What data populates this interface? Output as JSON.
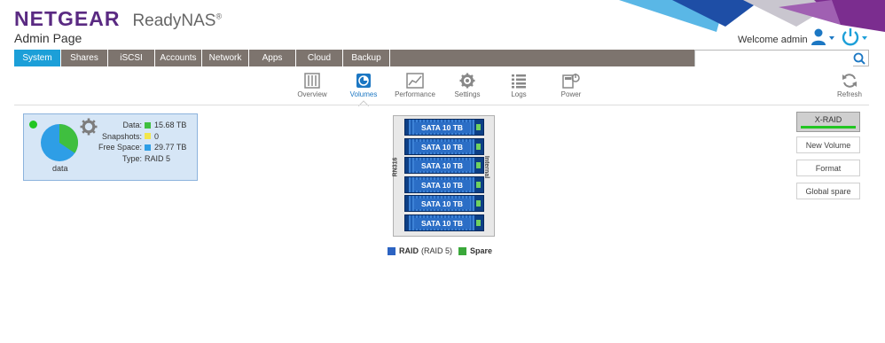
{
  "brand": {
    "name": "NETGEAR",
    "product": "ReadyNAS",
    "mark": "®"
  },
  "page": {
    "subtitle": "Admin Page"
  },
  "user": {
    "welcome": "Welcome admin"
  },
  "tabs": [
    {
      "label": "System",
      "active": true
    },
    {
      "label": "Shares"
    },
    {
      "label": "iSCSI"
    },
    {
      "label": "Accounts"
    },
    {
      "label": "Network"
    },
    {
      "label": "Apps"
    },
    {
      "label": "Cloud"
    },
    {
      "label": "Backup"
    }
  ],
  "search": {
    "value": "",
    "placeholder": ""
  },
  "subnav": [
    {
      "label": "Overview",
      "icon": "overview-icon"
    },
    {
      "label": "Volumes",
      "icon": "volumes-icon",
      "active": true
    },
    {
      "label": "Performance",
      "icon": "performance-icon"
    },
    {
      "label": "Settings",
      "icon": "settings-icon"
    },
    {
      "label": "Logs",
      "icon": "logs-icon"
    },
    {
      "label": "Power",
      "icon": "power-icon"
    }
  ],
  "refresh": {
    "label": "Refresh"
  },
  "volume": {
    "name": "data",
    "status_color": "#22c622",
    "usage_fraction": {
      "data": 0.345,
      "free_space": 0.655
    },
    "stats": [
      {
        "key": "Data:",
        "value": "15.68 TB",
        "color": "#3fbf3f"
      },
      {
        "key": "Snapshots:",
        "value": "0",
        "color": "#f2e64c"
      },
      {
        "key": "Free Space:",
        "value": "29.77 TB",
        "color": "#2e9ee6"
      },
      {
        "key": "Type:",
        "value": "RAID 5"
      }
    ]
  },
  "chassis": {
    "model": "RN316",
    "location": "Internal",
    "disks": [
      "SATA 10 TB",
      "SATA 10 TB",
      "SATA 10 TB",
      "SATA 10 TB",
      "SATA 10 TB",
      "SATA 10 TB"
    ]
  },
  "legend": {
    "raid_name": "RAID",
    "raid_level": "(RAID 5)",
    "spare": "Spare",
    "raid_color": "#2c63c2",
    "spare_color": "#3aa83a"
  },
  "actions": {
    "xraid": "X-RAID",
    "new_volume": "New Volume",
    "format": "Format",
    "global_spare": "Global spare"
  },
  "colors": {
    "brand": "#5a2a82",
    "accent": "#1c9fd8",
    "tabbar": "#7d746e"
  }
}
